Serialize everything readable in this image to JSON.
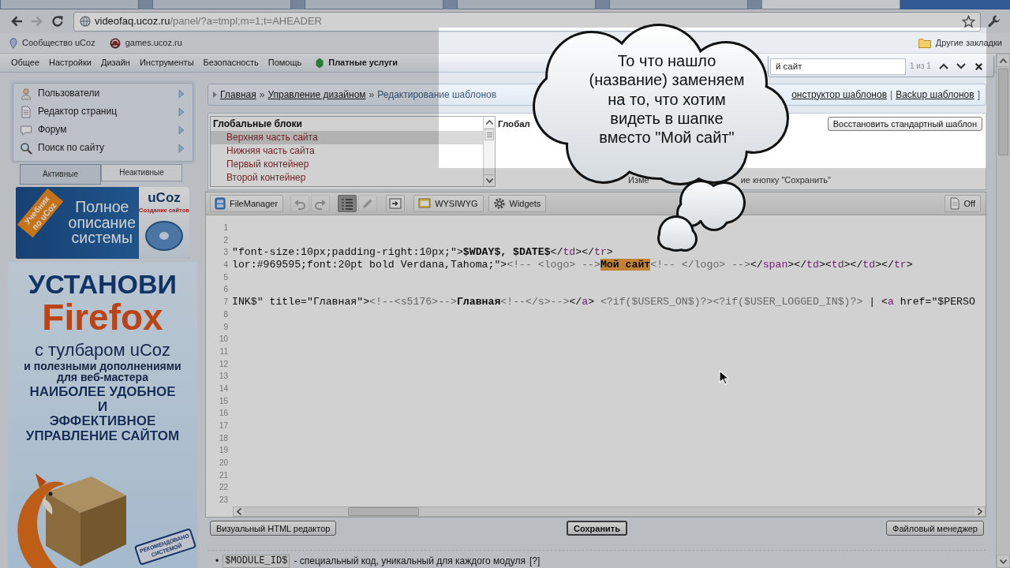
{
  "browser_tabs": [
    {
      "selected": false
    },
    {
      "selected": false
    },
    {
      "selected": false
    },
    {
      "selected": false
    },
    {
      "selected": false
    },
    {
      "selected": true
    }
  ],
  "nav_buttons": [
    {
      "kind": "back",
      "disabled": false
    },
    {
      "kind": "forward",
      "disabled": true
    },
    {
      "kind": "reload",
      "disabled": false
    }
  ],
  "address_bar": {
    "host": "videofaq.ucoz.ru",
    "path": "/panel/?a=tmpl;m=1;t=AHEADER"
  },
  "bookmarks": [
    {
      "label": "Сообщество uCoz",
      "kind": "community"
    },
    {
      "label": "games.ucoz.ru",
      "kind": "site"
    }
  ],
  "other_bookmarks": "Другие закладки",
  "find_bar": {
    "value": "й сайт",
    "count": "1 из 1"
  },
  "menu": [
    {
      "label": "Общее",
      "kind": "plain"
    },
    {
      "label": "Настройки",
      "kind": "plain"
    },
    {
      "label": "Дизайн",
      "kind": "plain"
    },
    {
      "label": "Инструменты",
      "kind": "plain"
    },
    {
      "label": "Безопасность",
      "kind": "plain"
    },
    {
      "label": "Помощь",
      "kind": "plain"
    },
    {
      "label": "Платные услуги",
      "kind": "featured"
    }
  ],
  "sidebar": {
    "items": [
      {
        "label": "Пользователи",
        "kind": "users"
      },
      {
        "label": "Редактор страниц",
        "kind": "pages"
      },
      {
        "label": "Форум",
        "kind": "forum"
      },
      {
        "label": "Поиск по сайту",
        "kind": "search"
      }
    ],
    "tabs": [
      {
        "label": "Активные",
        "selected": true
      },
      {
        "label": "Неактивные",
        "selected": false
      }
    ],
    "tutorial_banner": {
      "ribbon": "Учебник по uCoz",
      "title": [
        "Полное",
        "описание",
        "системы"
      ],
      "book_title": "uCoz",
      "book_subtitle": "Создание сайтов"
    },
    "firefox_banner": {
      "headline": "УСТАНОВИ",
      "brand": "Firefox",
      "subtitle": "с тулбаром uCoz",
      "note": [
        "и полезными дополнениями",
        "для веб-мастера"
      ],
      "slogan": [
        "НАИБОЛЕЕ УДОБНОЕ",
        "И",
        "ЭФФЕКТИВНОЕ",
        "УПРАВЛЕНИЕ САЙТОМ"
      ],
      "stamp": [
        "РЕКОМЕНДОВАНО",
        "СИСТЕМОЙ"
      ]
    }
  },
  "breadcrumbs": [
    {
      "label": "Главная",
      "kind": "link"
    },
    {
      "label": "»",
      "kind": "separator"
    },
    {
      "label": "Управление дизайном",
      "kind": "link"
    },
    {
      "label": "»",
      "kind": "separator"
    },
    {
      "label": "Редактирование шаблонов",
      "kind": "current"
    }
  ],
  "template_links": [
    {
      "label": "онструктор шаблонов",
      "kind": "link"
    },
    {
      "label": "|",
      "kind": "separator"
    },
    {
      "label": "Backup шаблонов",
      "kind": "link"
    },
    {
      "label": "]",
      "kind": "separator"
    }
  ],
  "template_list": {
    "heading": "Глобальные блоки",
    "items": [
      {
        "label": "Верхняя часть сайта",
        "selected": true
      },
      {
        "label": "Нижняя часть сайта",
        "selected": false
      },
      {
        "label": "Первый контейнер",
        "selected": false
      },
      {
        "label": "Второй контейнер",
        "selected": false
      }
    ]
  },
  "template_title": "Глобал",
  "restore_button": "Восстановить стандартный шаблон",
  "hint": [
    "Изме",
    "ие кнопку \"Сохранить\""
  ],
  "editor": {
    "toolbar": [
      {
        "kind": "file_manager",
        "label": "FileManager",
        "disabled": false,
        "on": false
      },
      {
        "kind": "undo",
        "disabled": true,
        "on": false
      },
      {
        "kind": "redo",
        "disabled": true,
        "on": false
      },
      {
        "kind": "line_numbers",
        "disabled": false,
        "on": true
      },
      {
        "kind": "edit",
        "disabled": true,
        "on": false
      },
      {
        "kind": "preview",
        "disabled": false,
        "on": false
      },
      {
        "kind": "wysiwyg",
        "label": "WYSIWYG",
        "disabled": false,
        "on": false
      },
      {
        "kind": "widgets",
        "label": "Widgets",
        "disabled": false,
        "on": false
      }
    ],
    "toggle": "Off",
    "lines": [
      {
        "number": "1"
      },
      {
        "number": "2"
      },
      {
        "number": "3",
        "segments": [
          {
            "text": "\"font-size:10px;padding-right:10px;\">",
            "kind": "plain"
          },
          {
            "text": "$WDAY$, $DATE$",
            "kind": "variable"
          },
          {
            "text": "</",
            "kind": "plain"
          },
          {
            "text": "td",
            "kind": "tag"
          },
          {
            "text": "></",
            "kind": "plain"
          },
          {
            "text": "tr",
            "kind": "tag"
          },
          {
            "text": ">",
            "kind": "plain"
          }
        ]
      },
      {
        "number": "4",
        "segments": [
          {
            "text": "lor:#969595;font:20pt bold Verdana,Tahoma;\">",
            "kind": "plain"
          },
          {
            "text": "<!-- <logo> -->",
            "kind": "comment"
          },
          {
            "text": "Мой сайт",
            "kind": "match"
          },
          {
            "text": "<!-- </logo> -->",
            "kind": "comment"
          },
          {
            "text": "</",
            "kind": "plain"
          },
          {
            "text": "span",
            "kind": "tag"
          },
          {
            "text": "></",
            "kind": "plain"
          },
          {
            "text": "td",
            "kind": "tag"
          },
          {
            "text": "><",
            "kind": "plain"
          },
          {
            "text": "td",
            "kind": "tag"
          },
          {
            "text": "></",
            "kind": "plain"
          },
          {
            "text": "td",
            "kind": "tag"
          },
          {
            "text": "></",
            "kind": "plain"
          },
          {
            "text": "tr",
            "kind": "tag"
          },
          {
            "text": ">",
            "kind": "plain"
          }
        ]
      },
      {
        "number": "5"
      },
      {
        "number": "6"
      },
      {
        "number": "7",
        "segments": [
          {
            "text": "INK$\" title=\"Главная\">",
            "kind": "plain"
          },
          {
            "text": "<!--<s5176>-->",
            "kind": "comment"
          },
          {
            "text": "Главная",
            "kind": "variable"
          },
          {
            "text": "<!--</s>-->",
            "kind": "comment"
          },
          {
            "text": "</",
            "kind": "plain"
          },
          {
            "text": "a",
            "kind": "tag"
          },
          {
            "text": "> ",
            "kind": "plain"
          },
          {
            "text": "<?if($USERS_ON$)?><?if($USER_LOGGED_IN$)?>",
            "kind": "comment"
          },
          {
            "text": " | <",
            "kind": "plain"
          },
          {
            "text": "a",
            "kind": "tag"
          },
          {
            "text": " href=\"$PERSO",
            "kind": "plain"
          }
        ]
      },
      {
        "number": "8"
      },
      {
        "number": "9"
      },
      {
        "number": "10"
      },
      {
        "number": "11"
      },
      {
        "number": "12"
      },
      {
        "number": "13"
      },
      {
        "number": "14"
      },
      {
        "number": "15"
      },
      {
        "number": "16"
      },
      {
        "number": "17"
      },
      {
        "number": "18"
      },
      {
        "number": "19"
      },
      {
        "number": "20"
      },
      {
        "number": "21"
      },
      {
        "number": "22"
      },
      {
        "number": "23"
      }
    ]
  },
  "buttons": [
    {
      "label": "Визуальный HTML редактор",
      "kind": "plain"
    },
    {
      "label": "Сохранить",
      "kind": "primary"
    },
    {
      "label": "Файловый менеджер",
      "kind": "plain"
    }
  ],
  "footnote": {
    "bullet": "•",
    "code": "$MODULE_ID$",
    "text": "- специальный код, уникальный для каждого модуля",
    "help": "[?]"
  },
  "callout": {
    "lines": [
      "То что нашло",
      "(название) заменяем",
      "на то, что хотим",
      "видеть в шапке",
      "вместо \"Мой сайт\""
    ]
  }
}
